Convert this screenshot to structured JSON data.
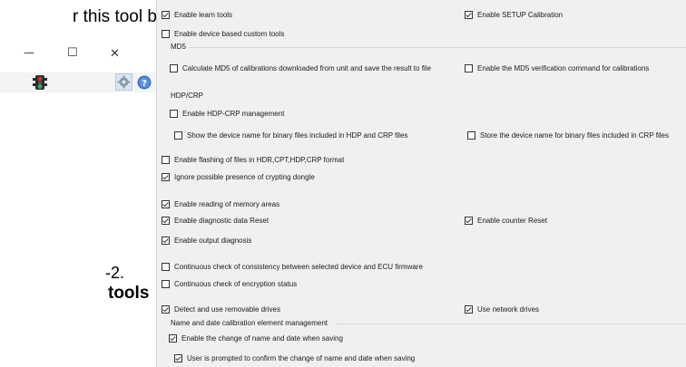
{
  "document": {
    "line1": "r this tool by",
    "line2": "-2.",
    "line3": "tools"
  },
  "window_controls": {
    "minimize": "—",
    "maximize": "☐",
    "close": "✕"
  },
  "settings": {
    "enable_learn_tools": {
      "label": "Enable learn tools",
      "checked": true
    },
    "enable_setup_calibration": {
      "label": "Enable SETUP Calibration",
      "checked": true
    },
    "enable_device_custom_tools": {
      "label": "Enable device based custom tools",
      "checked": false
    },
    "md5_group": "MD5",
    "calc_md5": {
      "label": "Calculate MD5 of calibrations downloaded from unit and save the result to file",
      "checked": false
    },
    "md5_verification": {
      "label": "Enable the MD5 verification command for calibrations",
      "checked": false
    },
    "hdp_group": "HDP/CRP",
    "enable_hdp_crp": {
      "label": "Enable HDP-CRP management",
      "checked": false
    },
    "show_device_name": {
      "label": "Show the device name for binary files included in HDP and CRP files",
      "checked": false
    },
    "store_device_name": {
      "label": "Store the device name for binary files included in CRP files",
      "checked": false
    },
    "enable_flashing": {
      "label": "Enable flashing of files in HDR,CPT,HDP,CRP format",
      "checked": false
    },
    "ignore_dongle": {
      "label": "Ignore possible presence of crypting dongle",
      "checked": true
    },
    "enable_reading_memory": {
      "label": "Enable reading of memory areas",
      "checked": true
    },
    "enable_diag_reset": {
      "label": "Enable diagnostic data Reset",
      "checked": true
    },
    "enable_counter_reset": {
      "label": "Enable counter Reset",
      "checked": true
    },
    "enable_output_diag": {
      "label": "Enable output diagnosis",
      "checked": true
    },
    "continuous_consistency": {
      "label": "Continuous check of consistency between selected device and ECU firmware",
      "checked": false
    },
    "continuous_encryption": {
      "label": "Continuous check of encryption status",
      "checked": false
    },
    "detect_removable": {
      "label": "Detect and use removable drives",
      "checked": true
    },
    "use_network": {
      "label": "Use network drives",
      "checked": true
    },
    "name_date_group": "Name and date calibration element management",
    "enable_change_name_date": {
      "label": "Enable the change of name and date when saving",
      "checked": true
    },
    "user_prompted": {
      "label": "User is prompted to confirm the change of name and date when saving",
      "checked": true
    }
  },
  "colors": {
    "panel_bg": "#f0f0f0",
    "traffic_red": "#c0392b",
    "traffic_green": "#27ae60",
    "help_blue": "#3a6fc4"
  }
}
